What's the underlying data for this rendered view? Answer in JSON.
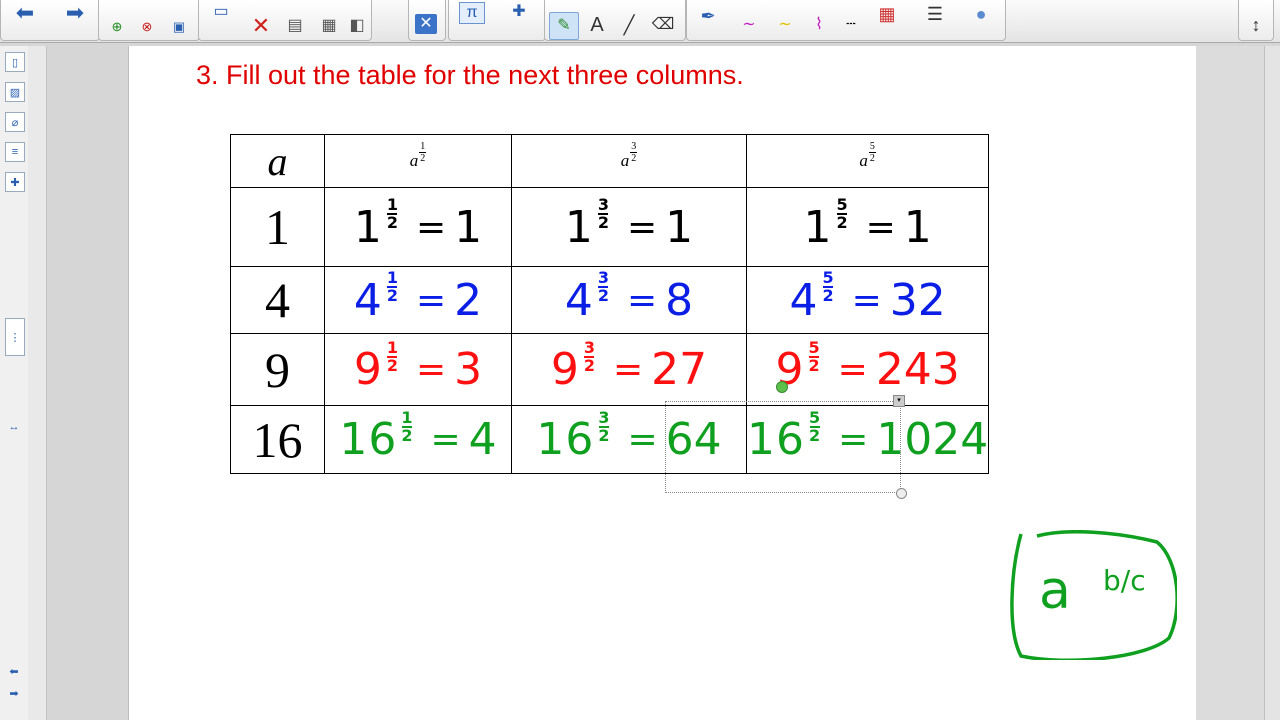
{
  "title": "3. Fill out the table for the next three columns.",
  "table": {
    "header_a": "a",
    "header_exponents": [
      {
        "base": "a",
        "num": "1",
        "den": "2"
      },
      {
        "base": "a",
        "num": "3",
        "den": "2"
      },
      {
        "base": "a",
        "num": "5",
        "den": "2"
      }
    ],
    "rows": [
      {
        "a": "1",
        "color": "#000000",
        "cells": [
          {
            "base": "1",
            "num": "1",
            "den": "2",
            "result": "1"
          },
          {
            "base": "1",
            "num": "3",
            "den": "2",
            "result": "1"
          },
          {
            "base": "1",
            "num": "5",
            "den": "2",
            "result": "1"
          }
        ]
      },
      {
        "a": "4",
        "color": "#0a1ee6",
        "cells": [
          {
            "base": "4",
            "num": "1",
            "den": "2",
            "result": "2"
          },
          {
            "base": "4",
            "num": "3",
            "den": "2",
            "result": "8"
          },
          {
            "base": "4",
            "num": "5",
            "den": "2",
            "result": "32"
          }
        ]
      },
      {
        "a": "9",
        "color": "#ff1010",
        "cells": [
          {
            "base": "9",
            "num": "1",
            "den": "2",
            "result": "3"
          },
          {
            "base": "9",
            "num": "3",
            "den": "2",
            "result": "27"
          },
          {
            "base": "9",
            "num": "5",
            "den": "2",
            "result": "243"
          }
        ]
      },
      {
        "a": "16",
        "color": "#10a020",
        "cells": [
          {
            "base": "16",
            "num": "1",
            "den": "2",
            "result": "4"
          },
          {
            "base": "16",
            "num": "3",
            "den": "2",
            "result": "64"
          },
          {
            "base": "16",
            "num": "5",
            "den": "2",
            "result": "1024"
          }
        ]
      }
    ]
  },
  "annotation": {
    "base": "a",
    "exponent": "b/c",
    "color": "#10a020"
  },
  "toolbar": {
    "pi_label": "π",
    "text_label": "A",
    "icons": [
      "back-arrow-icon",
      "forward-arrow-icon",
      "new-page-icon",
      "delete-page-icon",
      "save-icon",
      "screen-share-icon",
      "delete-icon",
      "screen-shade-icon",
      "table-icon",
      "fill-icon",
      "close-box-icon",
      "math-icon",
      "add-on-icon",
      "select-icon",
      "pen-icon",
      "text-icon",
      "line-icon",
      "eraser-icon",
      "creative-pen-icon",
      "color-palette-icon",
      "line-style-icon",
      "fill-style-icon",
      "more-icon"
    ]
  }
}
